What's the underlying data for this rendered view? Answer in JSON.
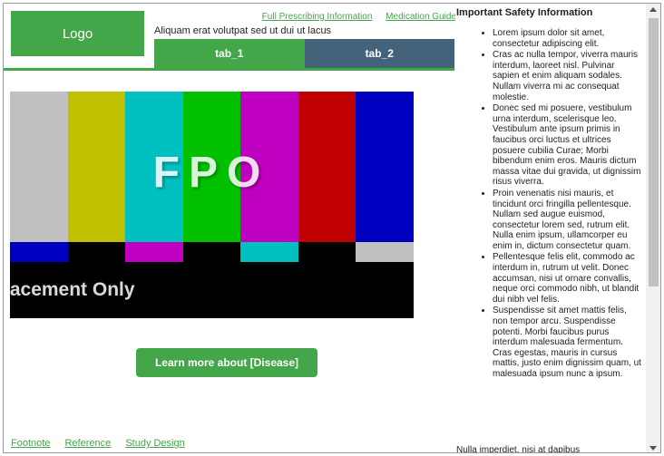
{
  "logo": {
    "label": "Logo"
  },
  "header": {
    "links": [
      "Full Prescribing Information",
      "Medication Guide"
    ],
    "tagline": "Aliquam erat volutpat sed ut dui ut lacus"
  },
  "tabs": [
    {
      "label": "tab_1",
      "active": true
    },
    {
      "label": "tab_2",
      "active": false
    }
  ],
  "media": {
    "overlay_text": "FPO",
    "overlay_sub": "lacement Only",
    "bar_colors_top": [
      "#c0c0c0",
      "#c0c000",
      "#00c0c0",
      "#00c000",
      "#c000c0",
      "#c00000",
      "#0000c0"
    ],
    "bar_colors_mid": [
      "#0000c0",
      "#000000",
      "#c000c0",
      "#000000",
      "#00c0c0",
      "#000000",
      "#c0c0c0"
    ],
    "bar_colors_bottom": [
      "#00214c",
      "#ffffff",
      "#32006a",
      "#131313",
      "#000000",
      "#080808",
      "#000000"
    ]
  },
  "cta": {
    "label": "Learn more about [Disease]"
  },
  "footer": {
    "links": [
      "Footnote",
      "Reference",
      "Study Design"
    ]
  },
  "isi": {
    "title": "Important Safety Information",
    "items": [
      "Lorem ipsum dolor sit amet, consectetur adipiscing elit.",
      "Cras ac nulla tempor, viverra mauris interdum, laoreet nisl. Pulvinar sapien et enim aliquam sodales. Nullam viverra mi ac consequat molestie.",
      "Donec sed mi posuere, vestibulum urna interdum, scelerisque leo. Vestibulum ante ipsum primis in faucibus orci luctus et ultrices posuere cubilia Curae; Morbi bibendum enim eros. Mauris dictum massa vitae dui gravida, ut dignissim risus viverra.",
      "Proin venenatis nisi mauris, et tincidunt orci fringilla pellentesque. Nullam sed augue euismod, consectetur lorem sed, rutrum elit. Nulla enim ipsum, ullamcorper eu enim in, dictum consectetur quam.",
      "Pellentesque felis elit, commodo ac interdum in, rutrum ut velit. Donec accumsan, nisi ut ornare convallis, neque orci commodo nibh, ut blandit dui nibh vel felis.",
      "Suspendisse sit amet mattis felis, non tempor arcu. Suspendisse potenti. Morbi faucibus purus interdum malesuada fermentum. Cras egestas, mauris in cursus mattis, justo enim dignissim quam, ut malesuada ipsum nunc a ipsum."
    ],
    "cutoff_text": "Nulla imperdiet, nisi at dapibus"
  },
  "colors": {
    "accent": "#43a648",
    "tab_inactive": "#44627a"
  }
}
